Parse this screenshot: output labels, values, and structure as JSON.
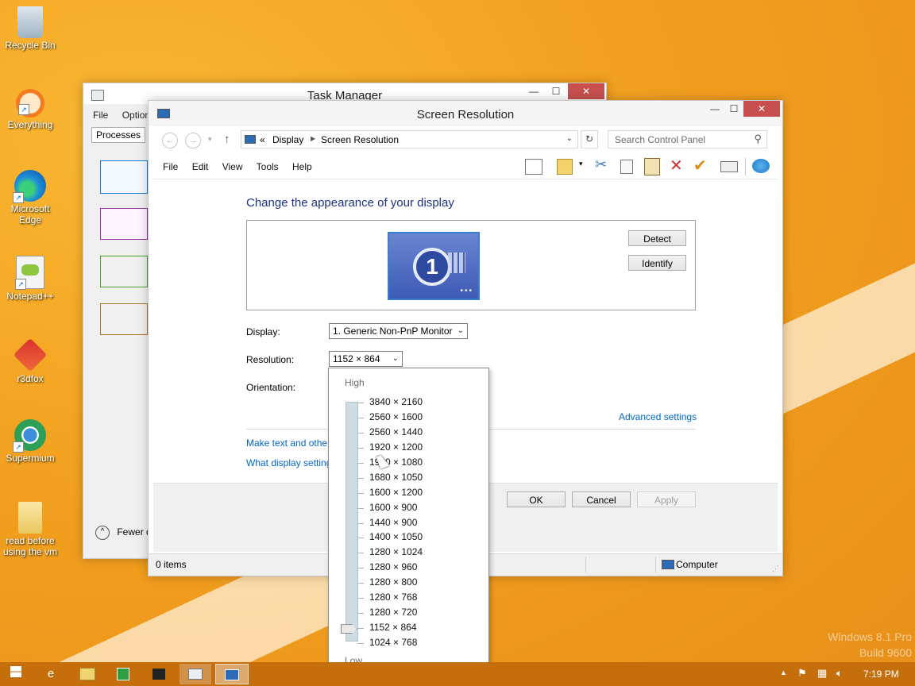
{
  "desktop": {
    "icons": [
      {
        "label": "Recycle Bin"
      },
      {
        "label": "Everything"
      },
      {
        "label": "Microsoft Edge"
      },
      {
        "label": "Notepad++"
      },
      {
        "label": "r3dfox"
      },
      {
        "label": "Supermium"
      },
      {
        "label": "read before using the vm"
      }
    ],
    "watermark_line1": "Windows 8.1 Pro",
    "watermark_line2": "Build 9600"
  },
  "task_manager": {
    "title": "Task Manager",
    "menu": [
      "File",
      "Options"
    ],
    "tab_processes": "Processes",
    "fewer_details": "Fewer details"
  },
  "screen_resolution": {
    "title": "Screen Resolution",
    "breadcrumb": {
      "prefix": "«",
      "items": [
        "Display",
        "Screen Resolution"
      ]
    },
    "search_placeholder": "Search Control Panel",
    "menu": [
      "File",
      "Edit",
      "View",
      "Tools",
      "Help"
    ],
    "heading": "Change the appearance of your display",
    "monitor_number": "1",
    "detect_label": "Detect",
    "identify_label": "Identify",
    "display_label": "Display:",
    "display_value": "1. Generic Non-PnP Monitor",
    "resolution_label": "Resolution:",
    "resolution_value": "1152 × 864",
    "orientation_label": "Orientation:",
    "advanced_settings": "Advanced settings",
    "link_text_size": "Make text and other items larger or smaller",
    "link_display_settings": "What display settings should I choose?",
    "ok_label": "OK",
    "cancel_label": "Cancel",
    "apply_label": "Apply",
    "status_items": "0 items",
    "status_computer": "Computer"
  },
  "resolution_dropdown": {
    "high_label": "High",
    "low_label": "Low",
    "options": [
      "3840 × 2160",
      "2560 × 1600",
      "2560 × 1440",
      "1920 × 1200",
      "1920 × 1080",
      "1680 × 1050",
      "1600 × 1200",
      "1600 × 900",
      "1440 × 900",
      "1400 × 1050",
      "1280 × 1024",
      "1280 × 960",
      "1280 × 800",
      "1280 × 768",
      "1280 × 720",
      "1152 × 864",
      "1024 × 768"
    ],
    "selected_index": 15
  },
  "taskbar": {
    "clock": "7:19 PM"
  }
}
